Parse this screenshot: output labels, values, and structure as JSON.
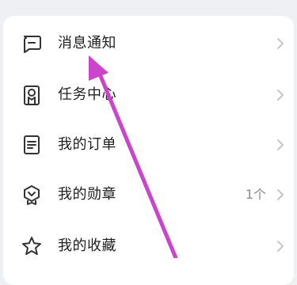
{
  "menu": {
    "items": [
      {
        "label": "消息通知",
        "icon": "message-icon",
        "count": ""
      },
      {
        "label": "任务中心",
        "icon": "badge-icon",
        "count": ""
      },
      {
        "label": "我的订单",
        "icon": "order-icon",
        "count": ""
      },
      {
        "label": "我的勋章",
        "icon": "medal-icon",
        "count": "1个"
      },
      {
        "label": "我的收藏",
        "icon": "star-icon",
        "count": ""
      }
    ]
  },
  "colors": {
    "background": "#eef0f3",
    "card": "#ffffff",
    "text": "#1f1f1f",
    "icon": "#333333",
    "chevron": "#c4c4c4",
    "annotation_arrow": "#cc44cc"
  }
}
